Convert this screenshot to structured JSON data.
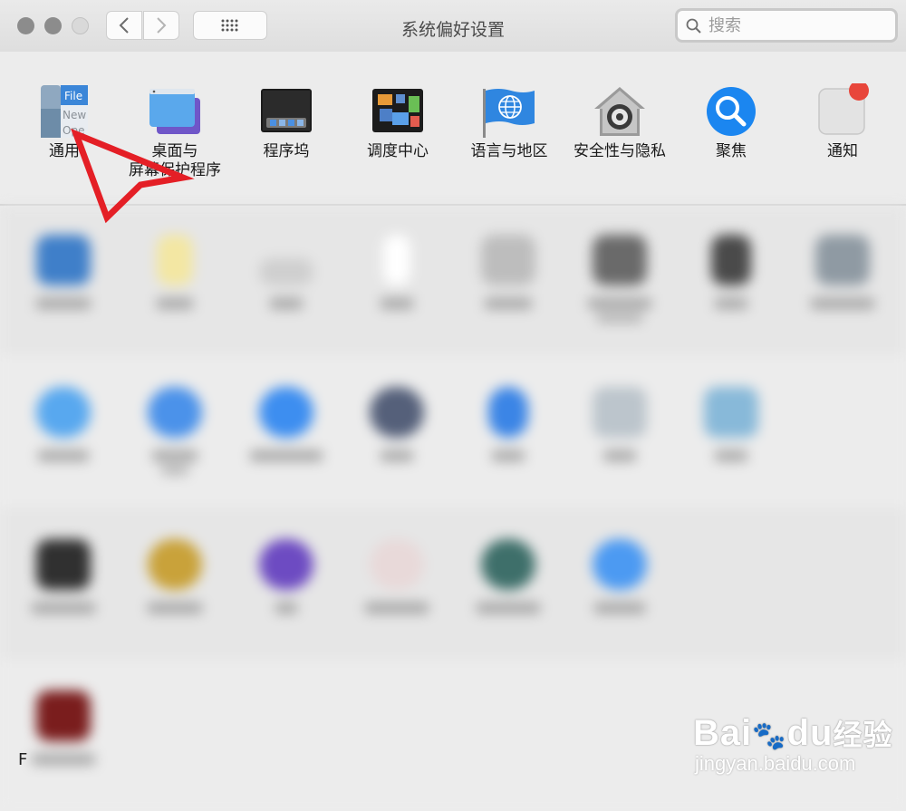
{
  "window": {
    "title": "系统偏好设置",
    "search_placeholder": "搜索"
  },
  "preferences_row1": [
    {
      "name": "general",
      "label": "通用",
      "icon": "general-icon"
    },
    {
      "name": "desktop-screensaver",
      "label": "桌面与",
      "label2": "屏幕保护程序",
      "icon": "desktop-screensaver-icon"
    },
    {
      "name": "dock",
      "label": "程序坞",
      "icon": "dock-icon"
    },
    {
      "name": "mission-control",
      "label": "调度中心",
      "icon": "mission-control-icon"
    },
    {
      "name": "language-region",
      "label": "语言与地区",
      "icon": "globe-flag-icon"
    },
    {
      "name": "security-privacy",
      "label": "安全性与隐私",
      "icon": "security-house-icon"
    },
    {
      "name": "spotlight",
      "label": "聚焦",
      "icon": "spotlight-magnifier-icon"
    },
    {
      "name": "notifications",
      "label": "通知",
      "icon": "notifications-icon"
    }
  ],
  "general_icon_text": {
    "line1": "File",
    "line2": "New",
    "line3": "Ope"
  },
  "blurred_fragment": "F",
  "watermark": {
    "brand": "Bai",
    "brand2": "du",
    "brand_cn": "经验",
    "url": "jingyan.baidu.com"
  },
  "colors": {
    "accent": "#e41f26",
    "spotlight": "#1b86f0",
    "notification_badge": "#e8463b"
  }
}
